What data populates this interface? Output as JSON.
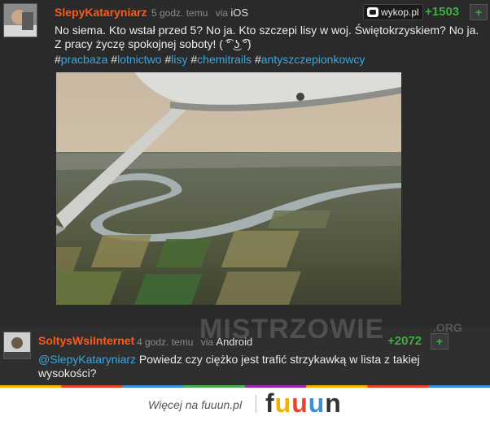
{
  "post": {
    "username": "SlepyKataryniarz",
    "time": "5 godz. temu",
    "via": "via",
    "platform": "iOS",
    "site_badge": "wykop.pl",
    "votes": "+1503",
    "plus": "+",
    "text": "No siema. Kto wstał przed 5? No ja. Kto szczepi lisy w woj. Świętokrzyskiem? No ja. Z pracy życzę spokojnej soboty! ( ͡° ͜ʖ ͡°)",
    "tags": [
      {
        "hash": "#",
        "name": "pracbaza"
      },
      {
        "hash": "#",
        "name": "lotnictwo"
      },
      {
        "hash": "#",
        "name": "lisy"
      },
      {
        "hash": "#",
        "name": "chemitrails"
      },
      {
        "hash": "#",
        "name": "antyszczepionkowcy"
      }
    ]
  },
  "reply": {
    "username": "SoltysWsiInternet",
    "time": "4 godz. temu",
    "via": "via",
    "platform": "Android",
    "votes": "+2072",
    "plus": "+",
    "mention": "@SlepyKataryniarz",
    "text": " Powiedz czy ciężko jest trafić strzykawką w lista z takiej wysokości?"
  },
  "watermark": {
    "main": "MISTRZOWIE",
    "org": ".ORG"
  },
  "footer": {
    "more_text": "Więcej na fuuun.pl",
    "logo": [
      "f",
      "u",
      "u",
      "u",
      "n"
    ],
    "logo_colors": [
      "#333333",
      "#f2b200",
      "#e8412c",
      "#3a8fd8",
      "#333333"
    ],
    "stripe_colors": [
      "#f2b200",
      "#e8412c",
      "#3a8fd8",
      "#4caf50",
      "#9c27b0",
      "#f2b200",
      "#e8412c",
      "#3a8fd8"
    ]
  }
}
